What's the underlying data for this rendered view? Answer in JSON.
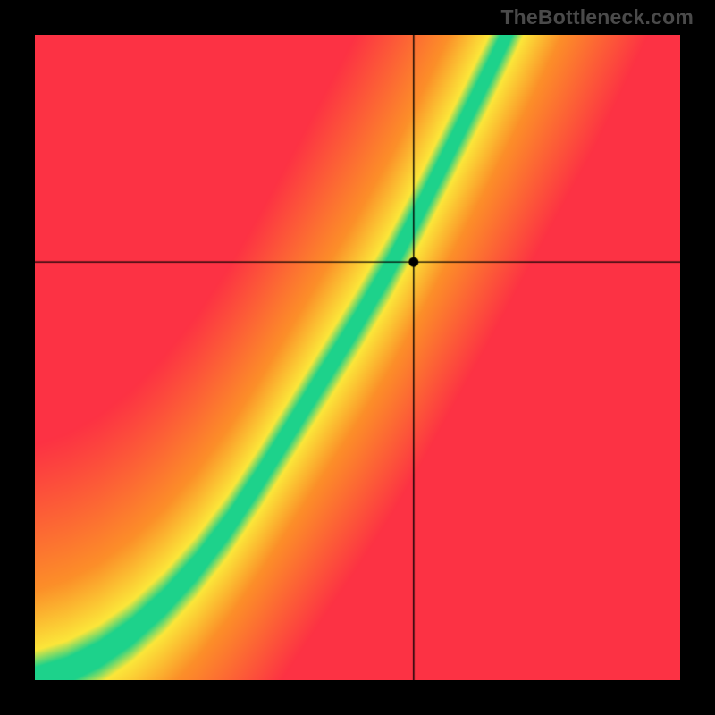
{
  "watermark": "TheBottleneck.com",
  "chart_data": {
    "type": "heatmap",
    "title": "",
    "xlabel": "",
    "ylabel": "",
    "xlim": [
      0,
      1
    ],
    "ylim": [
      0,
      1
    ],
    "crosshair": {
      "x": 0.587,
      "y": 0.648
    },
    "marker": {
      "x": 0.587,
      "y": 0.648
    },
    "optimal_curve_points": [
      {
        "x": 0.0,
        "y": 0.0
      },
      {
        "x": 0.05,
        "y": 0.015
      },
      {
        "x": 0.1,
        "y": 0.04
      },
      {
        "x": 0.15,
        "y": 0.075
      },
      {
        "x": 0.2,
        "y": 0.12
      },
      {
        "x": 0.25,
        "y": 0.175
      },
      {
        "x": 0.3,
        "y": 0.24
      },
      {
        "x": 0.35,
        "y": 0.315
      },
      {
        "x": 0.4,
        "y": 0.395
      },
      {
        "x": 0.45,
        "y": 0.475
      },
      {
        "x": 0.5,
        "y": 0.555
      },
      {
        "x": 0.55,
        "y": 0.64
      },
      {
        "x": 0.6,
        "y": 0.735
      },
      {
        "x": 0.65,
        "y": 0.835
      },
      {
        "x": 0.7,
        "y": 0.935
      },
      {
        "x": 0.75,
        "y": 1.04
      }
    ],
    "band_half_width": 0.055,
    "colors": {
      "green": "#1dd28b",
      "yellow": "#fbe73a",
      "orange": "#fc8f29",
      "red": "#fc3244"
    }
  }
}
